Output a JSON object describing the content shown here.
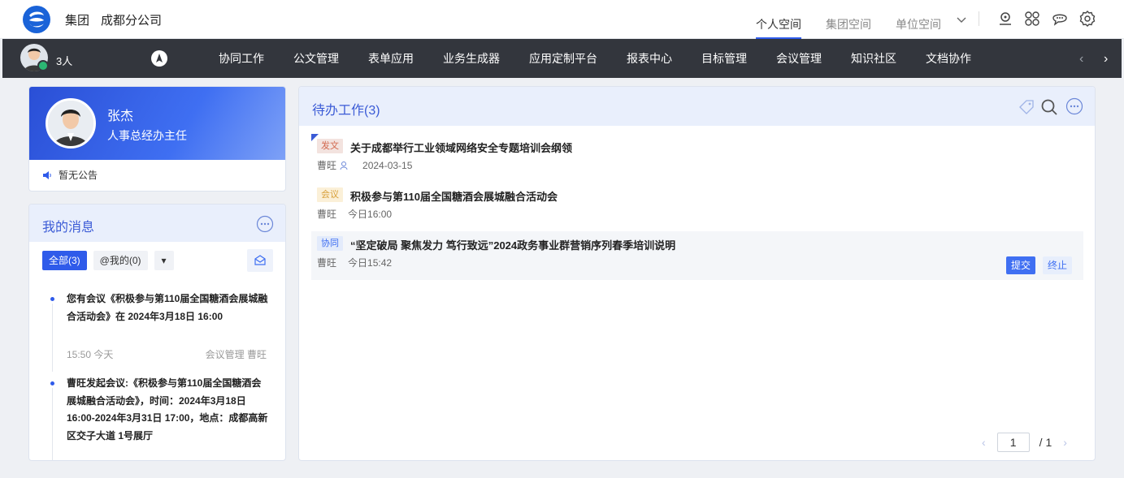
{
  "header": {
    "org_group": "集团",
    "org_unit": "成都分公司",
    "spaces": [
      "个人空间",
      "集团空间",
      "单位空间"
    ],
    "active_space": "个人空间"
  },
  "navbar": {
    "people_count": "3人",
    "items": [
      "协同工作",
      "公文管理",
      "表单应用",
      "业务生成器",
      "应用定制平台",
      "报表中心",
      "目标管理",
      "会议管理",
      "知识社区",
      "文档协作"
    ],
    "prev_arrow": "‹",
    "next_arrow": "›"
  },
  "profile": {
    "name": "张杰",
    "role": "人事总经办主任",
    "notice": "暂无公告"
  },
  "messages": {
    "title": "我的消息",
    "filters": {
      "all": "全部(3)",
      "mentions": "@我的(0)",
      "dropdown": "▾"
    },
    "items": [
      {
        "text": "您有会议《积极参与第110届全国糖酒会展城融合活动会》在 2024年3月18日 16:00",
        "time": "15:50 今天",
        "source": "会议管理 曹旺"
      },
      {
        "text": "曹旺发起会议:《积极参与第110届全国糖酒会展城融合活动会》，时间：2024年3月18日 16:00-2024年3月31日 17:00，地点：成都高新区交子大道 1号展厅"
      }
    ]
  },
  "todo": {
    "title": "待办工作(3)",
    "items": [
      {
        "tag": "发文",
        "tag_color": "#f3e3df",
        "tag_text_color": "#d26a50",
        "title": "关于成都举行工业领域网络安全专题培训会纲领",
        "sender": "曹旺",
        "date": "2024-03-15"
      },
      {
        "tag": "会议",
        "tag_color": "#fbf0d8",
        "tag_text_color": "#d8a03a",
        "title": "积极参与第110届全国糖酒会展城融合活动会",
        "sender": "曹旺",
        "date": "今日16:00"
      },
      {
        "tag": "协同",
        "tag_color": "#e3ebfb",
        "tag_text_color": "#3f6ff2",
        "title": "“坚定破局 聚焦发力 笃行致远”2024政务事业群营销序列春季培训说明",
        "sender": "曹旺",
        "date": "今日15:42",
        "actions": {
          "submit": "提交",
          "stop": "终止"
        }
      }
    ],
    "pagination": {
      "current": "1",
      "total": "/ 1",
      "prev": "‹",
      "next": "›"
    }
  },
  "colors": {
    "accent": "#2f5bea",
    "navbar": "#33363d",
    "online": "#2bb673"
  },
  "icons": [
    "logo-icon",
    "chevron-down-icon",
    "location-icon",
    "apps-icon",
    "chat-icon",
    "settings-icon",
    "compass-icon",
    "speaker-icon",
    "more-icon",
    "mail-open-icon",
    "tag-icon",
    "search-icon",
    "user-icon"
  ]
}
